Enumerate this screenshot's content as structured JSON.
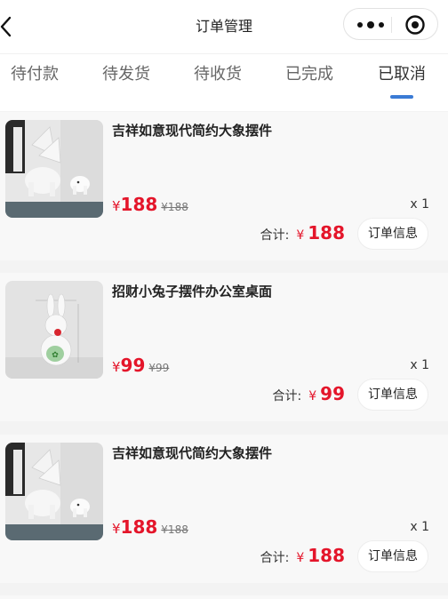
{
  "header": {
    "title": "订单管理",
    "back_icon": "chevron-left-icon",
    "more_icon": "more-dots-icon",
    "close_icon": "mini-program-close-icon"
  },
  "tabs": [
    {
      "label": "待付款",
      "active": false
    },
    {
      "label": "待发货",
      "active": false
    },
    {
      "label": "待收货",
      "active": false
    },
    {
      "label": "已完成",
      "active": false
    },
    {
      "label": "已取消",
      "active": true
    }
  ],
  "accent_color": "#3a7bd5",
  "price_color": "#e4152a",
  "orders": [
    {
      "name": "吉祥如意现代简约大象摆件",
      "image": "elephant-figurine",
      "price_symbol": "¥",
      "price": "188",
      "original_price": "¥188",
      "quantity": "x 1",
      "total_label": "合计:",
      "total_symbol": "¥",
      "total": "188",
      "button": "订单信息"
    },
    {
      "name": "招财小兔子摆件办公室桌面",
      "image": "rabbit-figurine",
      "price_symbol": "¥",
      "price": "99",
      "original_price": "¥99",
      "quantity": "x 1",
      "total_label": "合计:",
      "total_symbol": "¥",
      "total": "99",
      "button": "订单信息"
    },
    {
      "name": "吉祥如意现代简约大象摆件",
      "image": "elephant-figurine",
      "price_symbol": "¥",
      "price": "188",
      "original_price": "¥188",
      "quantity": "x 1",
      "total_label": "合计:",
      "total_symbol": "¥",
      "total": "188",
      "button": "订单信息"
    }
  ]
}
